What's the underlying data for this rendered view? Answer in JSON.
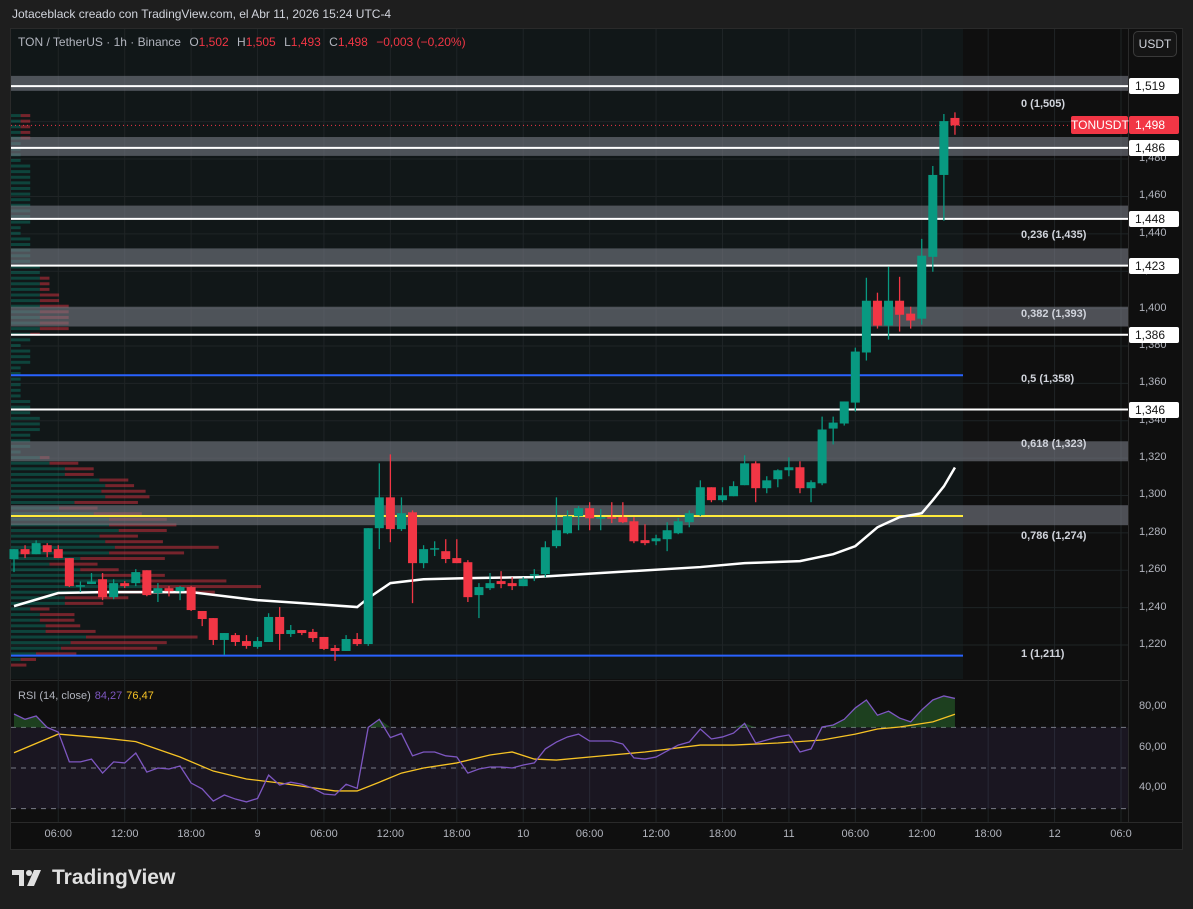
{
  "watermark": "Jotaceblack creado con TradingView.com, el Abr 11, 2026 15:24 UTC-4",
  "legend": {
    "symbol": "TON / TetherUS · 1h · Binance",
    "o_label": "O",
    "o": "1,502",
    "h_label": "H",
    "h": "1,505",
    "l_label": "L",
    "l": "1,493",
    "c_label": "C",
    "c": "1,498",
    "change": "−0,003 (−0,20%)"
  },
  "currency_button": "USDT",
  "price_label": {
    "ticker": "TONUSDT",
    "price": "1,498",
    "value": 1.498
  },
  "footer": {
    "logo_text": "TradingView"
  },
  "colors": {
    "up": "#089981",
    "down": "#f23645",
    "rsi": "#7e57c2",
    "rsi_ma": "#f7c325",
    "ma": "#ffffff",
    "hline_blue": "#2962ff",
    "hline_yellow": "#ffeb3b"
  },
  "chart_data": {
    "type": "candlestick",
    "title": "TON / TetherUS · 1h · Binance",
    "timeframe": "1h",
    "first_candle_time": "Apr 8 02:00",
    "ylim": [
      1.205,
      1.53
    ],
    "y_ticks": [
      "1,220",
      "1,240",
      "1,260",
      "1,280",
      "1,300",
      "1,320",
      "1,340",
      "1,360",
      "1,380",
      "1,400",
      "1,420",
      "1,440",
      "1,460",
      "1,480",
      "1,500"
    ],
    "y_tick_values": [
      1.22,
      1.24,
      1.26,
      1.28,
      1.3,
      1.32,
      1.34,
      1.36,
      1.38,
      1.4,
      1.42,
      1.44,
      1.46,
      1.48,
      1.5
    ],
    "x_ticks": [
      {
        "label": "06:00",
        "hour": 4
      },
      {
        "label": "12:00",
        "hour": 10
      },
      {
        "label": "18:00",
        "hour": 16
      },
      {
        "label": "9",
        "hour": 22
      },
      {
        "label": "06:00",
        "hour": 28
      },
      {
        "label": "12:00",
        "hour": 34
      },
      {
        "label": "18:00",
        "hour": 40
      },
      {
        "label": "10",
        "hour": 46
      },
      {
        "label": "06:00",
        "hour": 52
      },
      {
        "label": "12:00",
        "hour": 58
      },
      {
        "label": "18:00",
        "hour": 64
      },
      {
        "label": "11",
        "hour": 70
      },
      {
        "label": "06:00",
        "hour": 76
      },
      {
        "label": "12:00",
        "hour": 82
      },
      {
        "label": "18:00",
        "hour": 88
      },
      {
        "label": "12",
        "hour": 94
      },
      {
        "label": "06:0",
        "hour": 100
      }
    ],
    "ohlc": [
      [
        1.266,
        1.2713,
        1.259,
        1.2713
      ],
      [
        1.2713,
        1.2734,
        1.2665,
        1.2686
      ],
      [
        1.2686,
        1.276,
        1.2686,
        1.2745
      ],
      [
        1.2734,
        1.2745,
        1.267,
        1.2697
      ],
      [
        1.2713,
        1.2734,
        1.2665,
        1.2665
      ],
      [
        1.2665,
        1.2665,
        1.251,
        1.2515
      ],
      [
        1.2515,
        1.254,
        1.2483,
        1.252
      ],
      [
        1.2526,
        1.2585,
        1.2526,
        1.254
      ],
      [
        1.2552,
        1.2585,
        1.244,
        1.2456
      ],
      [
        1.2456,
        1.2552,
        1.2445,
        1.2531
      ],
      [
        1.2531,
        1.2542,
        1.2505,
        1.2515
      ],
      [
        1.2531,
        1.2606,
        1.2515,
        1.259
      ],
      [
        1.26,
        1.26,
        1.2461,
        1.2467
      ],
      [
        1.2478,
        1.2531,
        1.243,
        1.2504
      ],
      [
        1.2504,
        1.2515,
        1.246,
        1.2488
      ],
      [
        1.2488,
        1.2515,
        1.244,
        1.251
      ],
      [
        1.251,
        1.2515,
        1.2382,
        1.2387
      ],
      [
        1.2382,
        1.2382,
        1.2301,
        1.2339
      ],
      [
        1.2344,
        1.2344,
        1.22,
        1.2227
      ],
      [
        1.2227,
        1.2264,
        1.2147,
        1.2264
      ],
      [
        1.2253,
        1.2264,
        1.2195,
        1.2216
      ],
      [
        1.2221,
        1.2253,
        1.218,
        1.2195
      ],
      [
        1.219,
        1.2243,
        1.218,
        1.2221
      ],
      [
        1.2216,
        1.237,
        1.2216,
        1.235
      ],
      [
        1.235,
        1.2403,
        1.2173,
        1.2259
      ],
      [
        1.2259,
        1.2307,
        1.2243,
        1.228
      ],
      [
        1.228,
        1.228,
        1.2253,
        1.2264
      ],
      [
        1.227,
        1.2286,
        1.2216,
        1.2237
      ],
      [
        1.2243,
        1.2243,
        1.2173,
        1.2179
      ],
      [
        1.2184,
        1.22,
        1.2115,
        1.2168
      ],
      [
        1.2168,
        1.2253,
        1.2168,
        1.2232
      ],
      [
        1.2232,
        1.2264,
        1.2195,
        1.2205
      ],
      [
        1.2205,
        1.2825,
        1.2195,
        1.2825
      ],
      [
        1.2825,
        1.3172,
        1.2713,
        1.299
      ],
      [
        1.299,
        1.322,
        1.275,
        1.282
      ],
      [
        1.282,
        1.299,
        1.281,
        1.2905
      ],
      [
        1.291,
        1.292,
        1.2424,
        1.2638
      ],
      [
        1.2638,
        1.2734,
        1.2611,
        1.2713
      ],
      [
        1.2713,
        1.2755,
        1.2676,
        1.2718
      ],
      [
        1.2702,
        1.2766,
        1.2638,
        1.266
      ],
      [
        1.2665,
        1.2766,
        1.2638,
        1.2638
      ],
      [
        1.2643,
        1.2654,
        1.243,
        1.2456
      ],
      [
        1.2467,
        1.2531,
        1.2344,
        1.251
      ],
      [
        1.2504,
        1.2585,
        1.2494,
        1.2531
      ],
      [
        1.2542,
        1.2595,
        1.2504,
        1.2526
      ],
      [
        1.2531,
        1.2563,
        1.2494,
        1.2515
      ],
      [
        1.2515,
        1.2563,
        1.2515,
        1.2552
      ],
      [
        1.2574,
        1.2606,
        1.2542,
        1.2579
      ],
      [
        1.2579,
        1.2755,
        1.2563,
        1.2723
      ],
      [
        1.2729,
        1.299,
        1.2718,
        1.2814
      ],
      [
        1.2798,
        1.292,
        1.2793,
        1.2889
      ],
      [
        1.2889,
        1.2943,
        1.2814,
        1.2932
      ],
      [
        1.2932,
        1.2964,
        1.2814,
        1.2878
      ],
      [
        1.2878,
        1.2927,
        1.2814,
        1.2884
      ],
      [
        1.2884,
        1.2964,
        1.2852,
        1.2878
      ],
      [
        1.2884,
        1.2964,
        1.2852,
        1.2857
      ],
      [
        1.2862,
        1.2884,
        1.2745,
        1.2755
      ],
      [
        1.2761,
        1.2846,
        1.2734,
        1.2745
      ],
      [
        1.2755,
        1.279,
        1.2734,
        1.2771
      ],
      [
        1.2766,
        1.2857,
        1.2702,
        1.2814
      ],
      [
        1.2798,
        1.288,
        1.2793,
        1.2862
      ],
      [
        1.2857,
        1.292,
        1.283,
        1.2905
      ],
      [
        1.2895,
        1.3081,
        1.2889,
        1.3044
      ],
      [
        1.3044,
        1.3044,
        1.2964,
        1.2975
      ],
      [
        1.2975,
        1.3044,
        1.2964,
        1.3001
      ],
      [
        1.2996,
        1.3076,
        1.2996,
        1.305
      ],
      [
        1.3055,
        1.3215,
        1.3055,
        1.3172
      ],
      [
        1.3172,
        1.3183,
        1.2964,
        1.3039
      ],
      [
        1.3039,
        1.3103,
        1.3012,
        1.3081
      ],
      [
        1.3087,
        1.314,
        1.3044,
        1.3135
      ],
      [
        1.3135,
        1.3204,
        1.3103,
        1.3151
      ],
      [
        1.3151,
        1.3183,
        1.3012,
        1.3039
      ],
      [
        1.3039,
        1.3081,
        1.2964,
        1.3071
      ],
      [
        1.3065,
        1.3422,
        1.3055,
        1.3353
      ],
      [
        1.3358,
        1.3422,
        1.3273,
        1.339
      ],
      [
        1.3385,
        1.3503,
        1.3374,
        1.3503
      ],
      [
        1.3497,
        1.3791,
        1.3449,
        1.377
      ],
      [
        1.3765,
        1.4165,
        1.3722,
        1.4042
      ],
      [
        1.4042,
        1.4085,
        1.3893,
        1.3909
      ],
      [
        1.3909,
        1.4224,
        1.3834,
        1.4042
      ],
      [
        1.4042,
        1.417,
        1.3877,
        1.3967
      ],
      [
        1.3973,
        1.401,
        1.3893,
        1.3936
      ],
      [
        1.3946,
        1.4373,
        1.3914,
        1.4283
      ],
      [
        1.4277,
        1.4763,
        1.4197,
        1.4715
      ],
      [
        1.4715,
        1.5041,
        1.447,
        1.5003
      ],
      [
        1.502,
        1.505,
        1.493,
        1.498
      ]
    ],
    "moving_average": [
      [
        1,
        1.2408
      ],
      [
        5,
        1.2478
      ],
      [
        9,
        1.2483
      ],
      [
        17,
        1.2483
      ],
      [
        23,
        1.244
      ],
      [
        27,
        1.2424
      ],
      [
        32,
        1.2403
      ],
      [
        33,
        1.2451
      ],
      [
        35,
        1.2531
      ],
      [
        38,
        1.2552
      ],
      [
        42,
        1.2558
      ],
      [
        48,
        1.2563
      ],
      [
        54,
        1.2585
      ],
      [
        63,
        1.2617
      ],
      [
        67,
        1.2638
      ],
      [
        72,
        1.2649
      ],
      [
        75,
        1.2686
      ],
      [
        77,
        1.2729
      ],
      [
        79,
        1.283
      ],
      [
        81,
        1.2884
      ],
      [
        83,
        1.2905
      ],
      [
        84,
        1.2975
      ],
      [
        85,
        1.3049
      ],
      [
        86,
        1.315
      ]
    ],
    "horizontal_levels": [
      {
        "price": 1.519,
        "label": "1,519",
        "band": [
          1.5165,
          1.5245
        ]
      },
      {
        "price": 1.486,
        "label": "1,486",
        "band": [
          1.4817,
          1.4918
        ]
      },
      {
        "price": 1.448,
        "label": "1,448",
        "band": [
          1.4482,
          1.4551
        ]
      },
      {
        "price": 1.423,
        "label": "1,423",
        "band": [
          1.4231,
          1.4322
        ]
      },
      {
        "price": 1.386,
        "label": "1,386",
        "band": [
          1.3904,
          1.401
        ]
      },
      {
        "price": 1.346,
        "label": "1,346",
        "band": null
      }
    ],
    "zones": [
      [
        1.3183,
        1.329
      ],
      [
        1.2841,
        1.2948
      ]
    ],
    "yellow_line": 1.289,
    "blue_lines": [
      1.3643,
      1.2143
    ],
    "fibonacci": [
      {
        "label": "0 (1,505)",
        "price": 1.505
      },
      {
        "label": "0,236 (1,435)",
        "price": 1.435
      },
      {
        "label": "0,382 (1,393)",
        "price": 1.393
      },
      {
        "label": "0,5 (1,358)",
        "price": 1.358
      },
      {
        "label": "0,618 (1,323)",
        "price": 1.323
      },
      {
        "label": "0,786 (1,274)",
        "price": 1.274
      },
      {
        "label": "1 (1,211)",
        "price": 1.211
      }
    ],
    "rsi": {
      "legend": "RSI (14, close)",
      "value_label": "84,27",
      "ma_label": "76,47",
      "y_ticks": [
        "80,00",
        "60,00",
        "40,00"
      ],
      "y_tick_values": [
        80,
        60,
        40
      ],
      "bands": [
        70,
        50,
        30
      ],
      "values": [
        76.6,
        74,
        75.6,
        70,
        67.7,
        53,
        53,
        54.4,
        47.5,
        53,
        52.5,
        57.4,
        48,
        50,
        49.5,
        51,
        42.6,
        39.7,
        33.7,
        36.7,
        34.7,
        33.3,
        35,
        46.5,
        41.6,
        43,
        42,
        40,
        37.2,
        36.7,
        42,
        40,
        70,
        74,
        65,
        67,
        56,
        57.9,
        57.9,
        56,
        55.4,
        47.5,
        49.5,
        50.5,
        50.5,
        50,
        51.5,
        52.5,
        59.4,
        62.8,
        65.3,
        66.7,
        63.3,
        63.3,
        63.3,
        61.8,
        55,
        54.4,
        55.4,
        58.4,
        61.3,
        62.8,
        69.2,
        64.3,
        65.3,
        67.2,
        72,
        62.3,
        63.8,
        65.3,
        66.3,
        57.9,
        59.4,
        70.2,
        71.2,
        74,
        79.6,
        83.5,
        76,
        78,
        74.6,
        72.7,
        78.6,
        83.5,
        85.5,
        84.27
      ],
      "ma": [
        [
          1,
          57.5
        ],
        [
          5,
          66.7
        ],
        [
          9,
          64.8
        ],
        [
          12,
          63
        ],
        [
          16,
          55.4
        ],
        [
          19,
          48.5
        ],
        [
          22,
          44.6
        ],
        [
          25,
          42.6
        ],
        [
          30,
          38.7
        ],
        [
          32,
          38.7
        ],
        [
          34,
          43
        ],
        [
          36,
          47.5
        ],
        [
          38,
          50
        ],
        [
          41,
          52.5
        ],
        [
          44,
          56.4
        ],
        [
          46,
          57.9
        ],
        [
          48,
          54.4
        ],
        [
          50,
          53.9
        ],
        [
          54,
          55.9
        ],
        [
          58,
          57.9
        ],
        [
          63,
          61.3
        ],
        [
          66,
          61.3
        ],
        [
          70,
          62.3
        ],
        [
          74,
          63.8
        ],
        [
          77,
          66.7
        ],
        [
          79,
          69.2
        ],
        [
          81,
          70.2
        ],
        [
          84,
          72.7
        ],
        [
          86,
          76.47
        ]
      ]
    }
  }
}
